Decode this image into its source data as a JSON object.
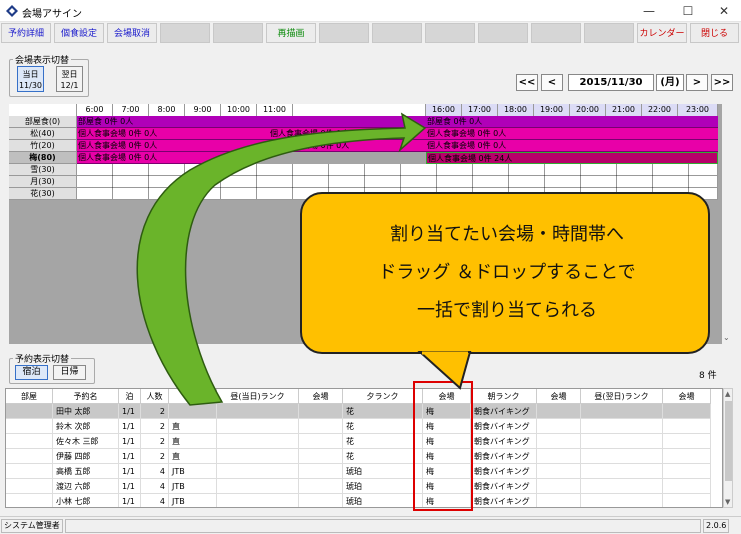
{
  "window": {
    "title": "会場アサイン"
  },
  "toolbar": {
    "reservation_detail": "予約詳細",
    "meal_settings": "個食設定",
    "venue_cancel": "会場取消",
    "redraw": "再描画",
    "calendar": "カレンダー",
    "close": "閉じる"
  },
  "venue_switch": {
    "label": "会場表示切替",
    "today_top": "当日",
    "today_date": "11/30",
    "next_top": "翌日",
    "next_date": "12/1"
  },
  "date_nav": {
    "first": "<<",
    "prev": "<",
    "date": "2015/11/30",
    "weekday": "(月)",
    "next": ">",
    "last": ">>"
  },
  "schedule": {
    "hours_left": [
      "6:00",
      "7:00",
      "8:00",
      "9:00",
      "10:00",
      "11:00"
    ],
    "hours_right": [
      "16:00",
      "17:00",
      "18:00",
      "19:00",
      "20:00",
      "21:00",
      "22:00",
      "23:00"
    ],
    "rooms": [
      "部屋食(0)",
      "松(40)",
      "竹(20)",
      "梅(80)",
      "雪(30)",
      "月(30)",
      "花(30)"
    ],
    "booking_purple": "部屋食 0件 0人",
    "booking_pink": "個人食事会場 0件 0人",
    "booking_selected": "個人食事会場 0件 24人"
  },
  "reservation_switch": {
    "label": "予約表示切替",
    "stay": "宿泊",
    "day_trip": "日帰"
  },
  "count": "8 件",
  "table": {
    "headers": [
      "部屋",
      "予約名",
      "泊",
      "人数",
      "",
      "昼(当日)ランク",
      "会場",
      "夕ランク",
      "会場",
      "朝ランク",
      "会場",
      "昼(翌日)ランク",
      "会場"
    ],
    "rows": [
      [
        "",
        "田中 太郎",
        "1/1",
        "2",
        "",
        "",
        "",
        "花",
        "梅",
        "朝食バイキング",
        "",
        "",
        ""
      ],
      [
        "",
        "鈴木 次郎",
        "1/1",
        "2",
        "直",
        "",
        "",
        "花",
        "梅",
        "朝食バイキング",
        "",
        "",
        ""
      ],
      [
        "",
        "佐々木 三郎",
        "1/1",
        "2",
        "直",
        "",
        "",
        "花",
        "梅",
        "朝食バイキング",
        "",
        "",
        ""
      ],
      [
        "",
        "伊藤 四郎",
        "1/1",
        "2",
        "直",
        "",
        "",
        "花",
        "梅",
        "朝食バイキング",
        "",
        "",
        ""
      ],
      [
        "",
        "高橋 五郎",
        "1/1",
        "4",
        "JTB",
        "",
        "",
        "琥珀",
        "梅",
        "朝食バイキング",
        "",
        "",
        ""
      ],
      [
        "",
        "渡辺 六郎",
        "1/1",
        "4",
        "JTB",
        "",
        "",
        "琥珀",
        "梅",
        "朝食バイキング",
        "",
        "",
        ""
      ],
      [
        "",
        "小林 七郎",
        "1/1",
        "4",
        "JTB",
        "",
        "",
        "琥珀",
        "梅",
        "朝食バイキング",
        "",
        "",
        ""
      ]
    ]
  },
  "status": {
    "user": "システム管理者",
    "version": "2.0.6"
  },
  "callout": {
    "line1": "割り当てたい会場・時間帯へ",
    "line2": "ドラッグ ＆ドロップすることで",
    "line3": "一括で割り当てられる"
  },
  "colors": {
    "accent_blue": "#1a1acc",
    "booking_purple": "#b000b8",
    "booking_pink": "#e800a8",
    "callout": "#ffc000",
    "arrow": "#6ab42a",
    "highlight_box": "#dd0000"
  }
}
